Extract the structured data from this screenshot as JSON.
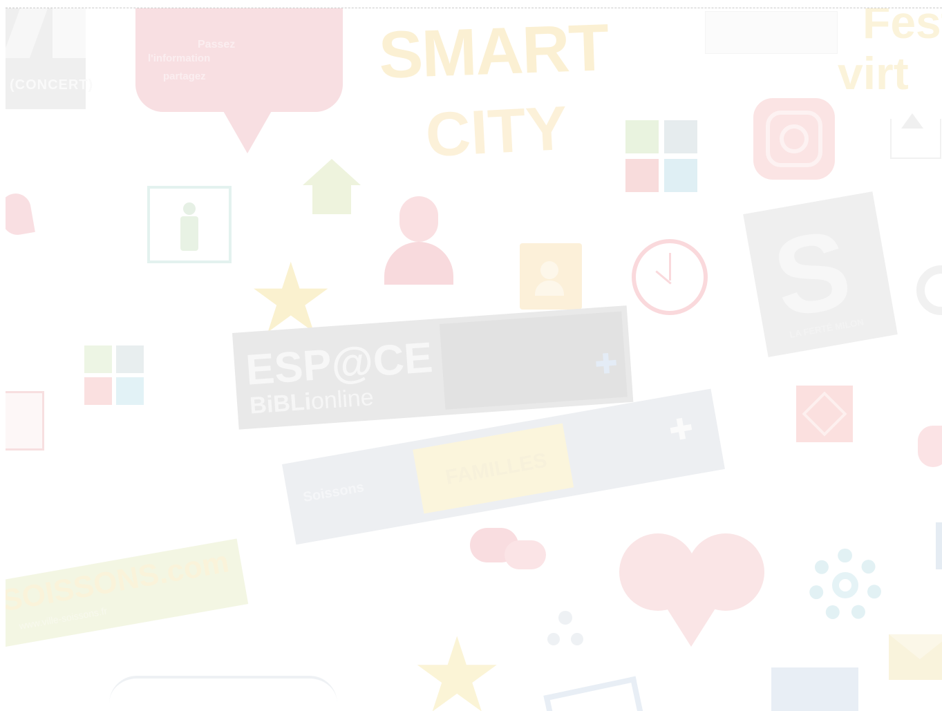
{
  "collage": {
    "smart_line1": "SMART",
    "smart_line2": "CITY",
    "top_left_badge": "(CONCERT)",
    "speech_bubble_line1": "Passez",
    "speech_bubble_line2": "l'information",
    "speech_bubble_line3": "partagez",
    "top_right_word1": "Fest",
    "top_right_word2": "virt",
    "espace_title": "ESP@CE",
    "espace_sub_bold": "BiBLi",
    "espace_sub_light": "online",
    "familles_banner_label": "FAMILLES",
    "familles_left_label": "Soissons",
    "soissons_band_text": "SOISSONS.com",
    "soissons_tagline": "www.ville-soissons.fr",
    "logo_s_caption": "LA FERTÉ MILON",
    "clock_label": "horloge",
    "colors": {
      "yellow": "#f7e3a4",
      "red": "#f4c9cb",
      "blue": "#dbe6f0",
      "green": "#e3f0d7",
      "gray": "#e8e8e8",
      "dark": "#e4e4e4"
    }
  }
}
